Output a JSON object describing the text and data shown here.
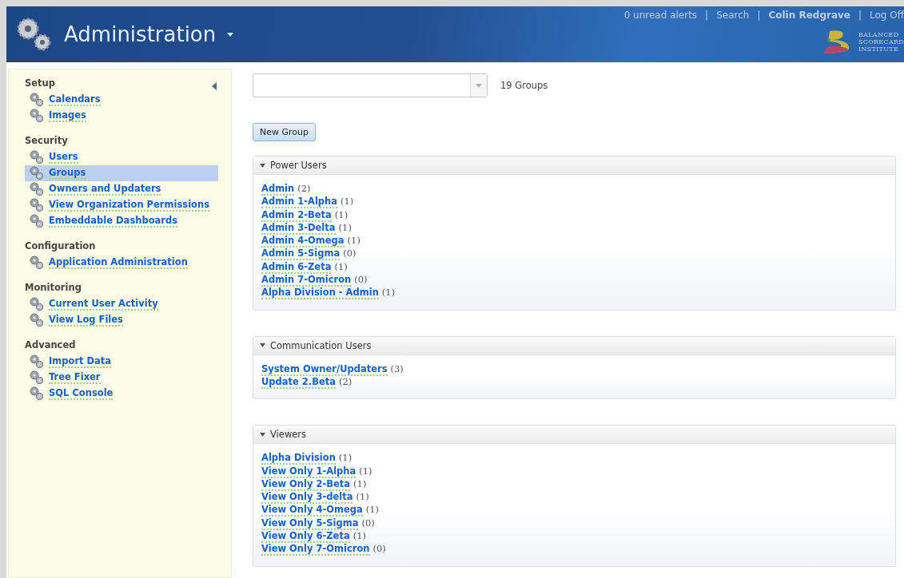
{
  "header": {
    "title": "Administration",
    "links": [
      {
        "kind": "link",
        "label": "0 unread alerts"
      },
      {
        "kind": "link",
        "label": "Search"
      },
      {
        "kind": "user",
        "label": "Colin Redgrave"
      },
      {
        "kind": "link",
        "label": "Log Off"
      }
    ],
    "separator": "|",
    "logo_lines": [
      "BALANCED",
      "SCORECARD",
      "INSTITUTE"
    ]
  },
  "sidebar": {
    "sections": [
      {
        "title": "Setup",
        "items": [
          {
            "label": "Calendars",
            "selected": false
          },
          {
            "label": "Images",
            "selected": false
          }
        ]
      },
      {
        "title": "Security",
        "items": [
          {
            "label": "Users",
            "selected": false
          },
          {
            "label": "Groups",
            "selected": true
          },
          {
            "label": "Owners and Updaters",
            "selected": false
          },
          {
            "label": "View Organization Permissions",
            "selected": false
          },
          {
            "label": "Embeddable Dashboards",
            "selected": false
          }
        ]
      },
      {
        "title": "Configuration",
        "items": [
          {
            "label": "Application Administration",
            "selected": false
          }
        ]
      },
      {
        "title": "Monitoring",
        "items": [
          {
            "label": "Current User Activity",
            "selected": false
          },
          {
            "label": "View Log Files",
            "selected": false
          }
        ]
      },
      {
        "title": "Advanced",
        "items": [
          {
            "label": "Import Data",
            "selected": false
          },
          {
            "label": "Tree Fixer",
            "selected": false
          },
          {
            "label": "SQL Console",
            "selected": false
          }
        ]
      }
    ]
  },
  "toolbar": {
    "count": "19 Groups",
    "new_button": "New Group"
  },
  "groups": [
    {
      "title": "Power Users",
      "expanded": true,
      "members": [
        {
          "name": "Admin",
          "count": "(2)"
        },
        {
          "name": "Admin 1-Alpha",
          "count": "(1)"
        },
        {
          "name": "Admin 2-Beta",
          "count": "(1)"
        },
        {
          "name": "Admin 3-Delta",
          "count": "(1)"
        },
        {
          "name": "Admin 4-Omega",
          "count": "(1)"
        },
        {
          "name": "Admin 5-Sigma",
          "count": "(0)"
        },
        {
          "name": "Admin 6-Zeta",
          "count": "(1)"
        },
        {
          "name": "Admin 7-Omicron",
          "count": "(0)"
        },
        {
          "name": "Alpha Division - Admin",
          "count": "(1)"
        }
      ]
    },
    {
      "title": "Communication Users",
      "expanded": true,
      "members": [
        {
          "name": "System Owner/Updaters",
          "count": "(3)"
        },
        {
          "name": "Update 2.Beta",
          "count": "(2)"
        }
      ]
    },
    {
      "title": "Viewers",
      "expanded": true,
      "members": [
        {
          "name": "Alpha Division",
          "count": "(1)"
        },
        {
          "name": "View Only 1-Alpha",
          "count": "(1)"
        },
        {
          "name": "View Only 2-Beta",
          "count": "(1)"
        },
        {
          "name": "View Only 3-delta",
          "count": "(1)"
        },
        {
          "name": "View Only 4-Omega",
          "count": "(1)"
        },
        {
          "name": "View Only 5-Sigma",
          "count": "(0)"
        },
        {
          "name": "View Only 6-Zeta",
          "count": "(1)"
        },
        {
          "name": "View Only 7-Omicron",
          "count": "(0)"
        }
      ]
    }
  ]
}
